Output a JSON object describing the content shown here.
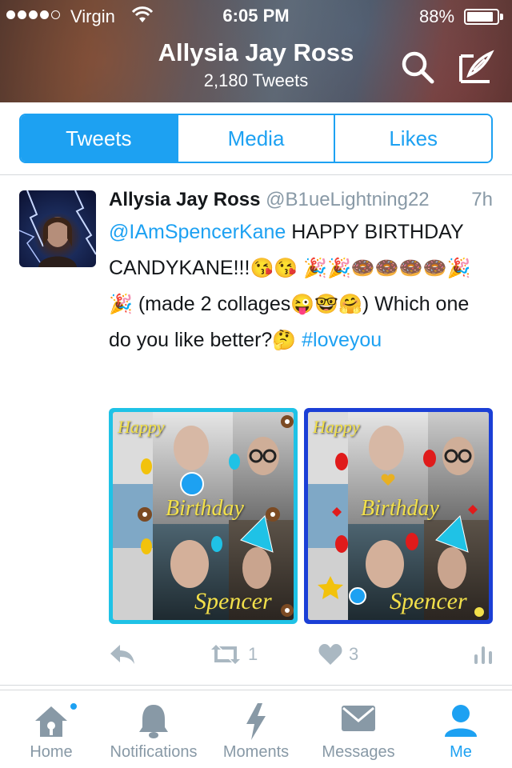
{
  "status_bar": {
    "carrier": "Virgin",
    "time": "6:05 PM",
    "battery": "88%",
    "battery_level": 0.88,
    "signal_bars": 4
  },
  "header": {
    "name": "Allysia Jay Ross",
    "tweet_count": "2,180 Tweets",
    "icons": [
      "search-icon",
      "compose-icon"
    ]
  },
  "tabs": [
    {
      "label": "Tweets",
      "active": true
    },
    {
      "label": "Media",
      "active": false
    },
    {
      "label": "Likes",
      "active": false
    }
  ],
  "tweet": {
    "author": "Allysia Jay Ross",
    "handle": "@B1ueLightning22",
    "time": "7h",
    "mention": "@IAmSpencerKane",
    "text_1": " HAPPY BIRTHDAY CANDYKANE!!!",
    "emoji_1": "😘😘",
    "emoji_2": "🎉🎉🍩🍩🍩🍩🎉🎉",
    "text_2": " (made 2 collages",
    "emoji_3": "😜🤓🤗",
    "text_3": ")  Which one do you like better?",
    "emoji_4": "🤔",
    "hashtag": " #loveyou",
    "media": [
      {
        "happy": "Happy",
        "birthday": "Birthday",
        "name": "Spencer",
        "frame_color": "#1fc2e6"
      },
      {
        "happy": "Happy",
        "birthday": "Birthday",
        "name": "Spencer",
        "frame_color": "#1b3fd6"
      }
    ],
    "actions": {
      "retweets": "1",
      "likes": "3"
    }
  },
  "tabbar": [
    {
      "label": "Home",
      "icon": "home-icon",
      "active": false
    },
    {
      "label": "Notifications",
      "icon": "bell-icon",
      "active": false
    },
    {
      "label": "Moments",
      "icon": "lightning-icon",
      "active": false
    },
    {
      "label": "Messages",
      "icon": "envelope-icon",
      "active": false
    },
    {
      "label": "Me",
      "icon": "person-icon",
      "active": true
    }
  ],
  "colors": {
    "accent": "#1da1f2",
    "muted": "#8899a6",
    "text": "#14171a"
  }
}
